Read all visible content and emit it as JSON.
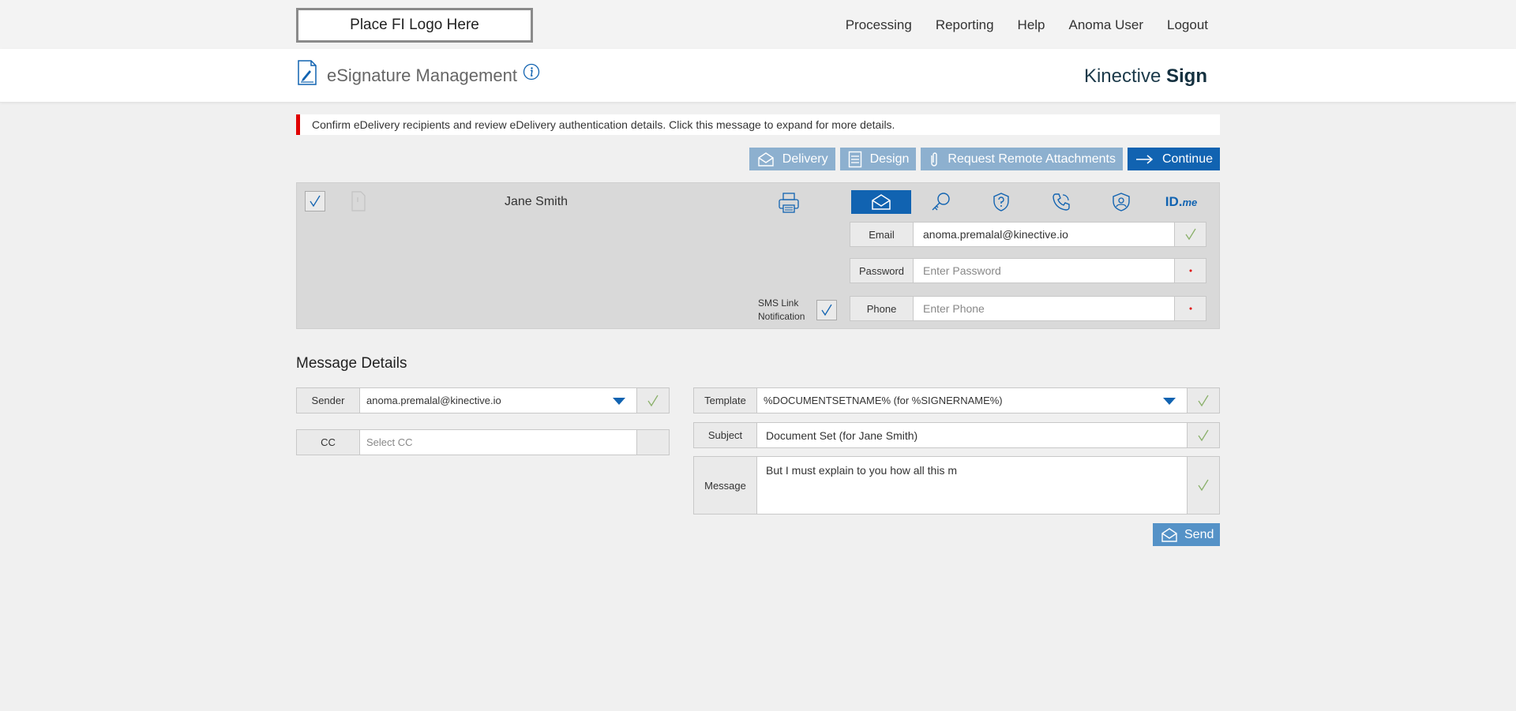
{
  "topbar": {
    "logo_text": "Place FI Logo Here",
    "nav": [
      "Processing",
      "Reporting",
      "Help",
      "Anoma User",
      "Logout"
    ]
  },
  "header": {
    "title": "eSignature Management",
    "brand_light": "Kinective",
    "brand_bold": "Sign"
  },
  "alert": {
    "text": "Confirm eDelivery recipients and review eDelivery authentication details. Click this message to expand for more details.",
    "color": "#e00000"
  },
  "actions": {
    "delivery": "Delivery",
    "design": "Design",
    "attachments": "Request Remote Attachments",
    "continue": "Continue"
  },
  "recipient": {
    "name": "Jane Smith",
    "checked": true,
    "auth_tabs": [
      "email-envelope-icon",
      "key-icon",
      "shield-question-icon",
      "phone-icon",
      "id-card-icon",
      "idme-logo"
    ],
    "idme_label": "ID.",
    "idme_suffix": "me",
    "email_label": "Email",
    "email_value": "anoma.premalal@kinective.io",
    "password_label": "Password",
    "password_placeholder": "Enter Password",
    "phone_label": "Phone",
    "phone_placeholder": "Enter Phone",
    "sms_label_line1": "SMS Link",
    "sms_label_line2": "Notification",
    "sms_checked": true
  },
  "message_details": {
    "title": "Message Details",
    "sender_label": "Sender",
    "sender_value": "anoma.premalal@kinective.io",
    "cc_label": "CC",
    "cc_placeholder": "Select CC",
    "template_label": "Template",
    "template_value": "%DOCUMENTSETNAME% (for %SIGNERNAME%)",
    "subject_label": "Subject",
    "subject_value": "Document Set (for Jane Smith)",
    "message_label": "Message",
    "message_value": "But I must explain to you how all this m",
    "send_label": "Send"
  },
  "colors": {
    "primary": "#1163b1",
    "button_light": "#8db0cf",
    "send": "#5592c7",
    "check_green": "#8ab06a",
    "required_red": "#e00000"
  }
}
